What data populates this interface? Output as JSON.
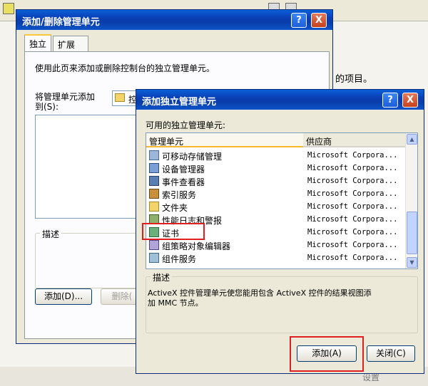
{
  "background": {
    "right_text": "的项目。",
    "footer_text": "设置"
  },
  "win1": {
    "title": "添加/删除管理单元",
    "help_btn": "?",
    "close_btn": "X",
    "tabs": [
      "独立",
      "扩展"
    ],
    "intro": "使用此页来添加或删除控制台的独立管理单元。",
    "add_to_label_line1": "将管理单元添加",
    "add_to_label_line2": "到(S):",
    "add_to_value": "控",
    "description_label": "描述",
    "add_button": "添加(D)...",
    "remove_button": "删除("
  },
  "win2": {
    "title": "添加独立管理单元",
    "help_btn": "?",
    "close_btn": "X",
    "available_label": "可用的独立管理单元:",
    "columns": [
      "管理单元",
      "供应商"
    ],
    "rows": [
      {
        "name": "可移动存储管理",
        "vendor": "Microsoft Corpora...",
        "icon": "removable-storage-icon"
      },
      {
        "name": "设备管理器",
        "vendor": "Microsoft Corpora...",
        "icon": "device-manager-icon"
      },
      {
        "name": "事件查看器",
        "vendor": "Microsoft Corpora...",
        "icon": "event-viewer-icon"
      },
      {
        "name": "索引服务",
        "vendor": "Microsoft Corpora...",
        "icon": "indexing-service-icon"
      },
      {
        "name": "文件夹",
        "vendor": "Microsoft Corpora...",
        "icon": "folder-icon"
      },
      {
        "name": "性能日志和警报",
        "vendor": "Microsoft Corpora...",
        "icon": "performance-icon"
      },
      {
        "name": "证书",
        "vendor": "Microsoft Corpora...",
        "icon": "certificate-icon"
      },
      {
        "name": "组策略对象编辑器",
        "vendor": "Microsoft Corpora...",
        "icon": "group-policy-icon"
      },
      {
        "name": "组件服务",
        "vendor": "Microsoft Corpora...",
        "icon": "component-services-icon"
      }
    ],
    "description_label": "描述",
    "description_text_line1": "ActiveX 控件管理单元使您能用包含 ActiveX 控件的结果视图添",
    "description_text_line2": "加 MMC 节点。",
    "add_button": "添加(A)",
    "close_button": "关闭(C)"
  },
  "colors": {
    "titlebar": "#0a3fb5",
    "window_face": "#ece9d8",
    "highlight_box": "#e02020"
  }
}
